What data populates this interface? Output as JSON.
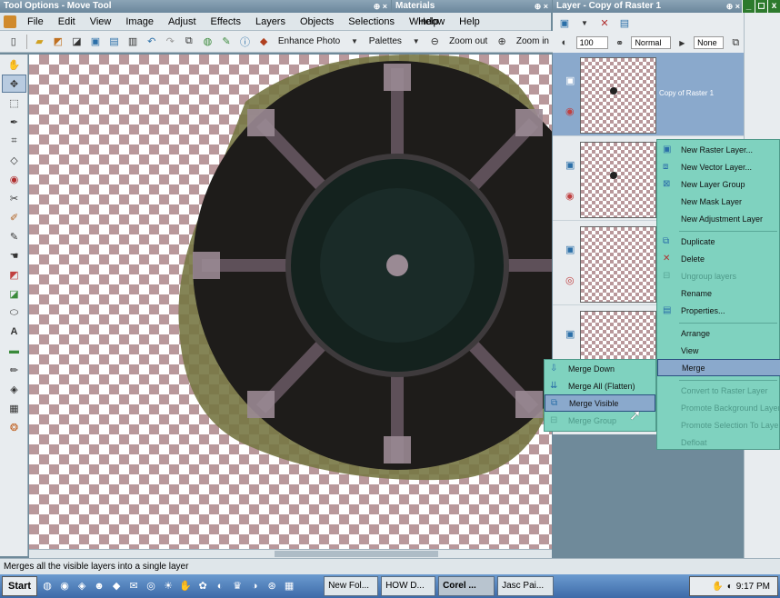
{
  "titlebars": {
    "tool_options": "Tool Options - Move Tool",
    "materials": "Materials",
    "layer": "Layer - Copy of Raster 1"
  },
  "window_buttons": [
    "_",
    "◻",
    "x"
  ],
  "menubar": [
    "File",
    "Edit",
    "View",
    "Image",
    "Adjust",
    "Effects",
    "Layers",
    "Objects",
    "Selections",
    "Window",
    "Help"
  ],
  "menubar_right": [
    "Help"
  ],
  "toolbar": {
    "enhance_photo": "Enhance Photo",
    "palettes": "Palettes",
    "zoom_out": "Zoom out",
    "zoom_in": "Zoom in"
  },
  "layer_palette": {
    "opacity": "100",
    "blend_mode": "Normal",
    "mask": "None",
    "layers": [
      {
        "name": "Copy of Raster 1",
        "selected": true,
        "has_dot": true
      },
      {
        "name": "",
        "selected": false,
        "has_dot": true
      },
      {
        "name": "",
        "selected": false,
        "has_dot": false
      },
      {
        "name": "",
        "selected": false,
        "has_dot": false
      }
    ]
  },
  "context_menu": [
    {
      "label": "New Raster Layer...",
      "icon": "raster-layer-icon",
      "disabled": false
    },
    {
      "label": "New Vector Layer...",
      "icon": "vector-layer-icon",
      "disabled": false
    },
    {
      "label": "New Layer Group",
      "icon": "layer-group-icon",
      "disabled": false
    },
    {
      "label": "New Mask Layer",
      "icon": "",
      "disabled": false
    },
    {
      "label": "New Adjustment Layer",
      "icon": "",
      "disabled": false
    },
    {
      "label": "Duplicate",
      "icon": "duplicate-icon",
      "disabled": false
    },
    {
      "label": "Delete",
      "icon": "delete-icon",
      "disabled": false
    },
    {
      "label": "Ungroup layers",
      "icon": "ungroup-icon",
      "disabled": true
    },
    {
      "label": "Rename",
      "icon": "",
      "disabled": false
    },
    {
      "label": "Properties...",
      "icon": "properties-icon",
      "disabled": false
    },
    {
      "label": "Arrange",
      "icon": "",
      "disabled": false
    },
    {
      "label": "View",
      "icon": "",
      "disabled": false
    },
    {
      "label": "Merge",
      "icon": "",
      "disabled": false
    },
    {
      "label": "Convert to Raster Layer",
      "icon": "",
      "disabled": true
    },
    {
      "label": "Promote Background Layer",
      "icon": "",
      "disabled": true
    },
    {
      "label": "Promote Selection To Layer",
      "icon": "",
      "disabled": true
    },
    {
      "label": "Defloat",
      "icon": "",
      "disabled": true
    }
  ],
  "merge_submenu": [
    {
      "label": "Merge Down",
      "disabled": false
    },
    {
      "label": "Merge All (Flatten)",
      "disabled": false
    },
    {
      "label": "Merge Visible",
      "disabled": false
    },
    {
      "label": "Merge Group",
      "disabled": true
    }
  ],
  "statusbar": "Merges all the visible layers into a single layer",
  "taskbar": {
    "start": "Start",
    "tasks": [
      {
        "label": "New Fol...",
        "active": false
      },
      {
        "label": "HOW D...",
        "active": false
      },
      {
        "label": "Corel ...",
        "active": true
      },
      {
        "label": "Jasc Pai...",
        "active": false
      }
    ],
    "clock": "9:17 PM"
  }
}
